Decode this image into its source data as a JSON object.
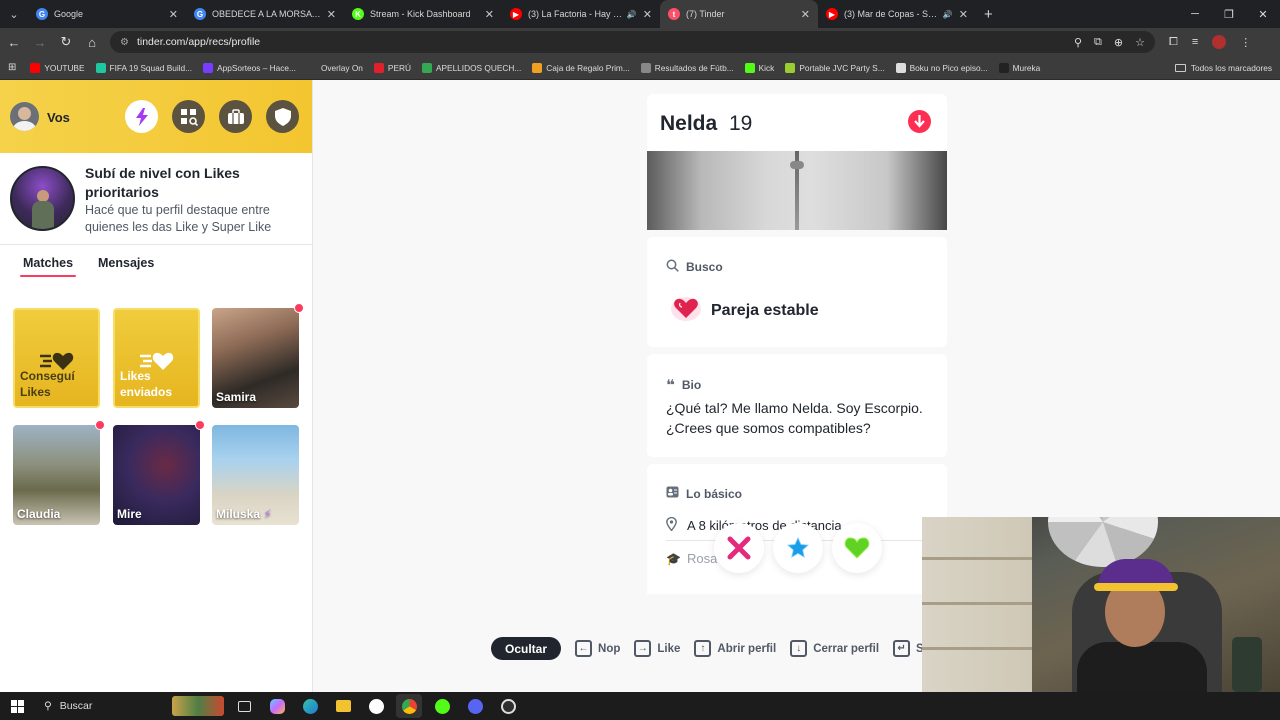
{
  "browser": {
    "tabs": [
      {
        "title": "Google",
        "favicon_color": "#4285f4",
        "favicon_glyph": "G",
        "active": false,
        "sound": false
      },
      {
        "title": "OBEDECE A LA MORSA - Busca",
        "favicon_color": "#4285f4",
        "favicon_glyph": "G",
        "active": false,
        "sound": false
      },
      {
        "title": "Stream - Kick Dashboard",
        "favicon_color": "#53fc18",
        "favicon_glyph": "K",
        "active": false,
        "sound": false
      },
      {
        "title": "(3) La Factoria - Hay Otro E",
        "favicon_color": "#ff0000",
        "favicon_glyph": "▶",
        "active": false,
        "sound": true
      },
      {
        "title": "(7) Tinder",
        "favicon_color": "#fd5068",
        "favicon_glyph": "t",
        "active": true,
        "sound": false
      },
      {
        "title": "(3) Mar de Copas - Suna (V",
        "favicon_color": "#ff0000",
        "favicon_glyph": "▶",
        "active": false,
        "sound": true
      }
    ],
    "url": "tinder.com/app/recs/profile",
    "bookmarks": [
      {
        "label": "YOUTUBE",
        "color": "#ff0000"
      },
      {
        "label": "FIFA 19 Squad Build...",
        "color": "#1ec8a0"
      },
      {
        "label": "AppSorteos – Hace...",
        "color": "#7a3cff"
      },
      {
        "label": "Overlay On",
        "color": "#3c3c3c"
      },
      {
        "label": "PERÚ",
        "color": "#e0202a"
      },
      {
        "label": "APELLIDOS QUECH...",
        "color": "#34a853"
      },
      {
        "label": "Caja de Regalo Prim...",
        "color": "#f0a020"
      },
      {
        "label": "Resultados de Fútb...",
        "color": "#888888"
      },
      {
        "label": "Kick",
        "color": "#53fc18"
      },
      {
        "label": "Portable JVC Party S...",
        "color": "#9acd32"
      },
      {
        "label": "Boku no Pico episo...",
        "color": "#dddddd"
      },
      {
        "label": "Mureka",
        "color": "#222222"
      }
    ],
    "all_bookmarks_label": "Todos los marcadores"
  },
  "sidebar": {
    "user_name": "Vos",
    "promo": {
      "title": "Subí de nivel con Likes prioritarios",
      "text": "Hacé que tu perfil destaque entre quienes les das Like y Super Like"
    },
    "tabs": {
      "matches": "Matches",
      "messages": "Mensajes"
    },
    "tiles": [
      {
        "label": "Conseguí Likes",
        "kind": "gold-get"
      },
      {
        "label": "Likes enviados",
        "kind": "gold-sent"
      },
      {
        "label": "Samira",
        "kind": "photo",
        "new": true
      },
      {
        "label": "Claudia",
        "kind": "photo",
        "new": true
      },
      {
        "label": "Mire",
        "kind": "photo",
        "new": true
      },
      {
        "label": "Miluska",
        "kind": "photo",
        "new": false
      }
    ]
  },
  "profile": {
    "name": "Nelda",
    "age": "19",
    "looking_for": {
      "heading": "Busco",
      "value": "Pareja estable"
    },
    "bio": {
      "heading": "Bio",
      "text": "¿Qué tal? Me llamo Nelda. Soy Escorpio. ¿Crees que somos compatibles?"
    },
    "basics": {
      "heading": "Lo básico",
      "distance": "A 8 kilómetros de distancia",
      "education": "Rosa"
    }
  },
  "shortcuts": {
    "hide": "Ocultar",
    "items": [
      {
        "key": "←",
        "label": "Nop"
      },
      {
        "key": "→",
        "label": "Like"
      },
      {
        "key": "↑",
        "label": "Abrir perfil"
      },
      {
        "key": "↓",
        "label": "Cerrar perfil"
      },
      {
        "key": "↵",
        "label": "Sup"
      }
    ]
  },
  "taskbar": {
    "search_placeholder": "Buscar"
  }
}
